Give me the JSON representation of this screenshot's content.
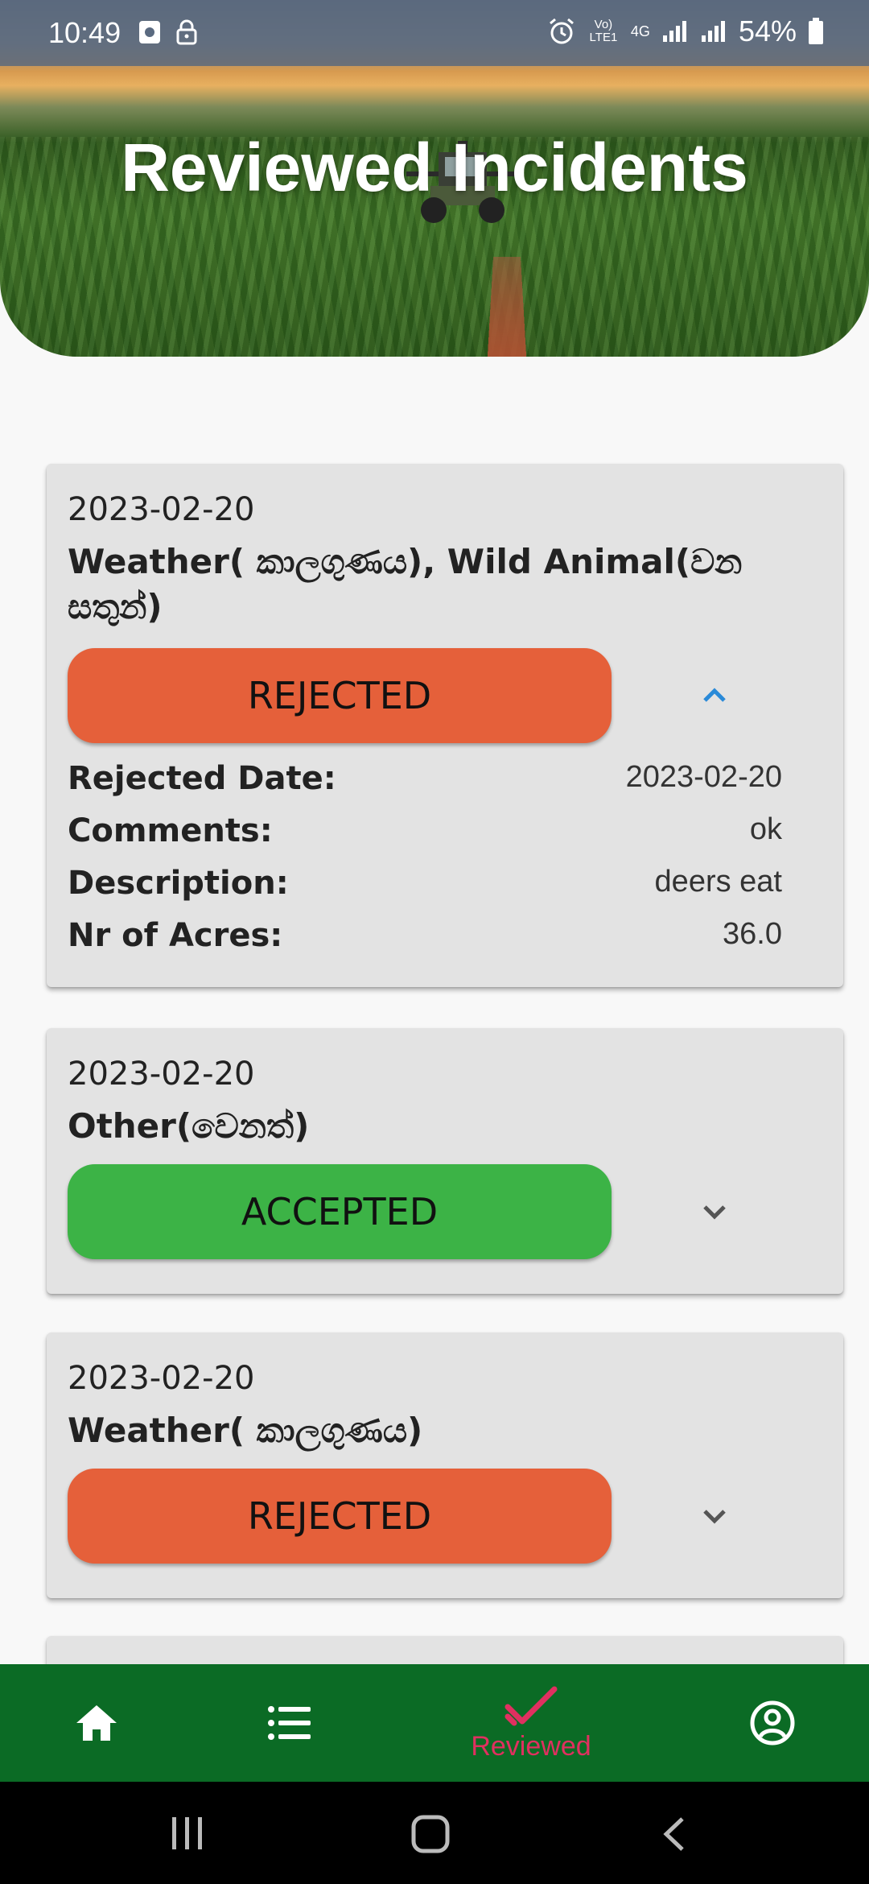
{
  "status_bar": {
    "time": "10:49",
    "battery": "54%",
    "network": "4G",
    "volte": "Vo) LTE1"
  },
  "header": {
    "title": "Reviewed Incidents"
  },
  "incidents": [
    {
      "date": "2023-02-20",
      "type": "Weather( කාලගුණය), Wild Animal(වන සතුන්)",
      "status": "REJECTED",
      "status_color": "#e5603a",
      "expanded": true,
      "details": [
        {
          "label": "Rejected Date:",
          "value": "2023-02-20"
        },
        {
          "label": "Comments:",
          "value": "ok"
        },
        {
          "label": "Description:",
          "value": "deers eat"
        },
        {
          "label": "Nr of Acres:",
          "value": "36.0"
        }
      ]
    },
    {
      "date": "2023-02-20",
      "type": "Other(වෙනත්)",
      "status": "ACCEPTED",
      "status_color": "#3cb346",
      "expanded": false
    },
    {
      "date": "2023-02-20",
      "type": "Weather( කාලගුණය)",
      "status": "REJECTED",
      "status_color": "#e5603a",
      "expanded": false
    }
  ],
  "bottom_nav": {
    "items": [
      {
        "icon": "home-icon"
      },
      {
        "icon": "list-icon"
      },
      {
        "icon": "check-icon",
        "label": "Reviewed",
        "active": true
      },
      {
        "icon": "account-circle-icon"
      }
    ],
    "background": "#0b6b25",
    "active_color": "#e03060"
  }
}
